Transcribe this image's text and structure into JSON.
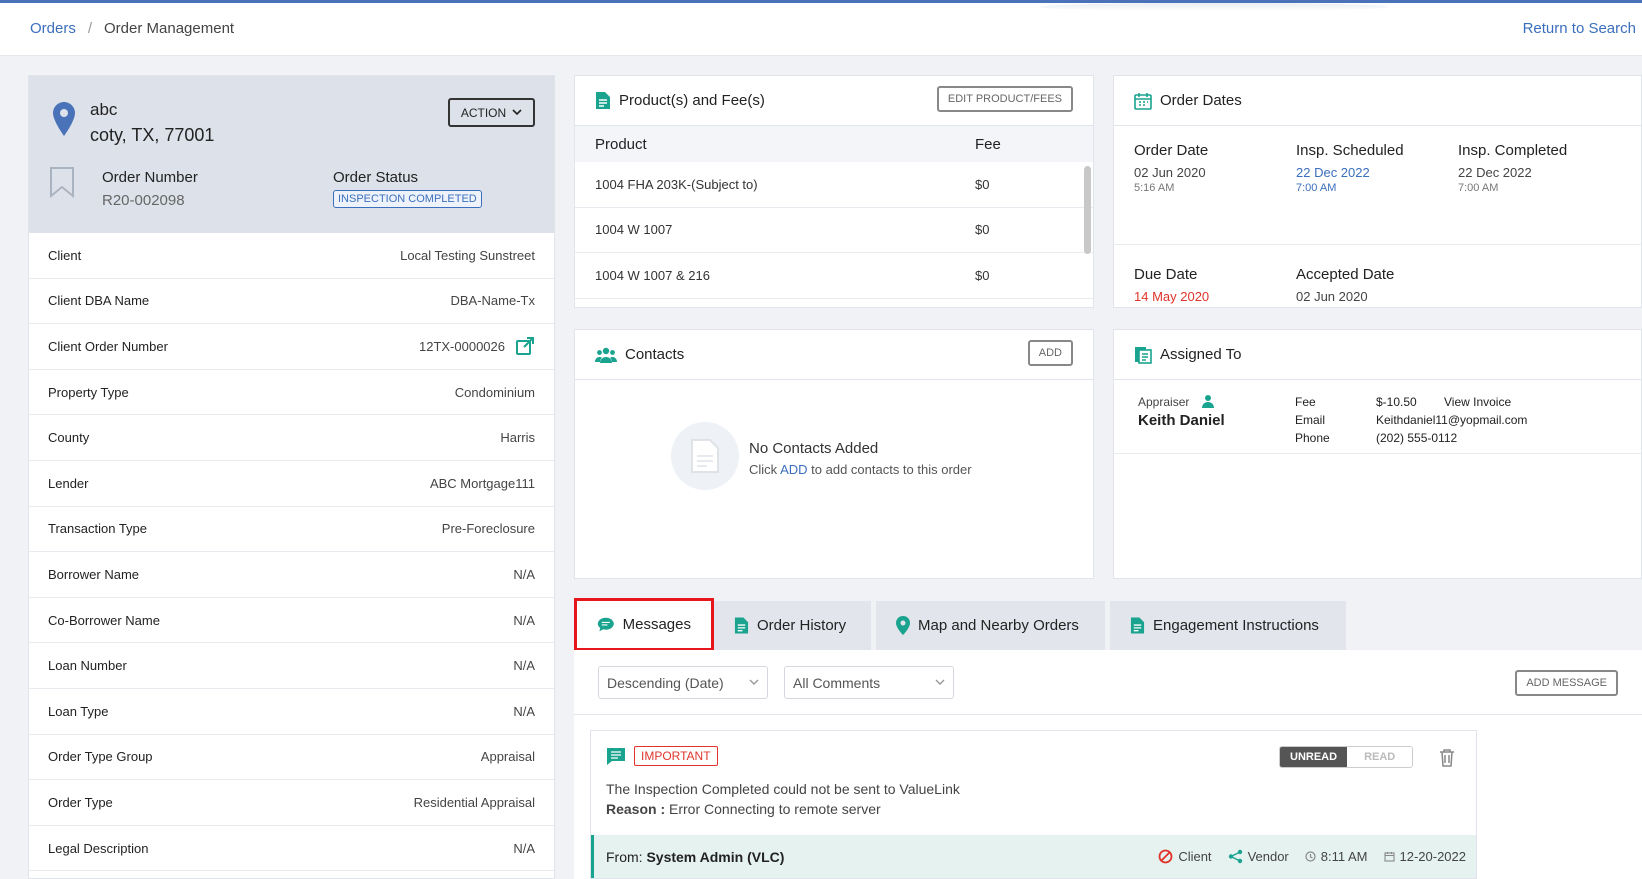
{
  "breadcrumb": {
    "root": "Orders",
    "separator": "/",
    "current": "Order Management"
  },
  "return_link": "Return to Search",
  "order": {
    "address_line1": "abc",
    "address_line2": "coty, TX, 77001",
    "action_label": "ACTION",
    "number_label": "Order Number",
    "number_value": "R20-002098",
    "status_label": "Order Status",
    "status_value": "INSPECTION COMPLETED"
  },
  "details": [
    {
      "label": "Client",
      "value": "Local Testing Sunstreet"
    },
    {
      "label": "Client DBA Name",
      "value": "DBA-Name-Tx"
    },
    {
      "label": "Client Order Number",
      "value": "12TX-0000026"
    },
    {
      "label": "Property Type",
      "value": "Condominium"
    },
    {
      "label": "County",
      "value": "Harris"
    },
    {
      "label": "Lender",
      "value": "ABC Mortgage111"
    },
    {
      "label": "Transaction Type",
      "value": "Pre-Foreclosure"
    },
    {
      "label": "Borrower Name",
      "value": "N/A"
    },
    {
      "label": "Co-Borrower Name",
      "value": "N/A"
    },
    {
      "label": "Loan Number",
      "value": "N/A"
    },
    {
      "label": "Loan Type",
      "value": "N/A"
    },
    {
      "label": "Order Type Group",
      "value": "Appraisal"
    },
    {
      "label": "Order Type",
      "value": "Residential Appraisal"
    },
    {
      "label": "Legal Description",
      "value": "N/A"
    }
  ],
  "products": {
    "title": "Product(s) and Fee(s)",
    "edit_label": "EDIT PRODUCT/FEES",
    "col_product": "Product",
    "col_fee": "Fee",
    "rows": [
      {
        "product": "1004 FHA 203K-(Subject to)",
        "fee": "$0"
      },
      {
        "product": "1004 W 1007",
        "fee": "$0"
      },
      {
        "product": "1004 W 1007 & 216",
        "fee": "$0"
      }
    ]
  },
  "dates": {
    "title": "Order Dates",
    "order_date_label": "Order Date",
    "order_date": "02 Jun 2020",
    "order_time": "5:16 AM",
    "insp_sched_label": "Insp. Scheduled",
    "insp_sched": "22 Dec 2022",
    "insp_sched_time": "7:00 AM",
    "insp_comp_label": "Insp. Completed",
    "insp_comp": "22 Dec 2022",
    "insp_comp_time": "7:00 AM",
    "due_label": "Due Date",
    "due": "14 May 2020",
    "accepted_label": "Accepted Date",
    "accepted": "02 Jun 2020"
  },
  "contacts": {
    "title": "Contacts",
    "add_label": "ADD",
    "empty_title": "No Contacts Added",
    "empty_pre": "Click",
    "empty_link": "ADD",
    "empty_post": "to add contacts to this order"
  },
  "assigned": {
    "title": "Assigned To",
    "role": "Appraiser",
    "name": "Keith Daniel",
    "fee_label": "Fee",
    "fee": "$-10.50",
    "invoice_link": "View Invoice",
    "email_label": "Email",
    "email": "Keithdaniel11@yopmail.com",
    "phone_label": "Phone",
    "phone": "(202) 555-0112"
  },
  "tabs": [
    {
      "label": "Messages"
    },
    {
      "label": "Order History"
    },
    {
      "label": "Map and Nearby Orders"
    },
    {
      "label": "Engagement Instructions"
    }
  ],
  "messages": {
    "sort_value": "Descending (Date)",
    "filter_value": "All Comments",
    "add_label": "ADD MESSAGE",
    "item": {
      "badge": "IMPORTANT",
      "unread": "UNREAD",
      "read": "READ",
      "text": "The Inspection Completed could not be sent to ValueLink",
      "reason_label": "Reason :",
      "reason": "Error Connecting to remote server",
      "from_label": "From:",
      "from": "System Admin (VLC)",
      "client": "Client",
      "vendor": "Vendor",
      "time": "8:11 AM",
      "date": "12-20-2022"
    }
  },
  "colors": {
    "accent": "#3b6fbd",
    "teal": "#1aa38f",
    "danger": "#e0342b"
  }
}
